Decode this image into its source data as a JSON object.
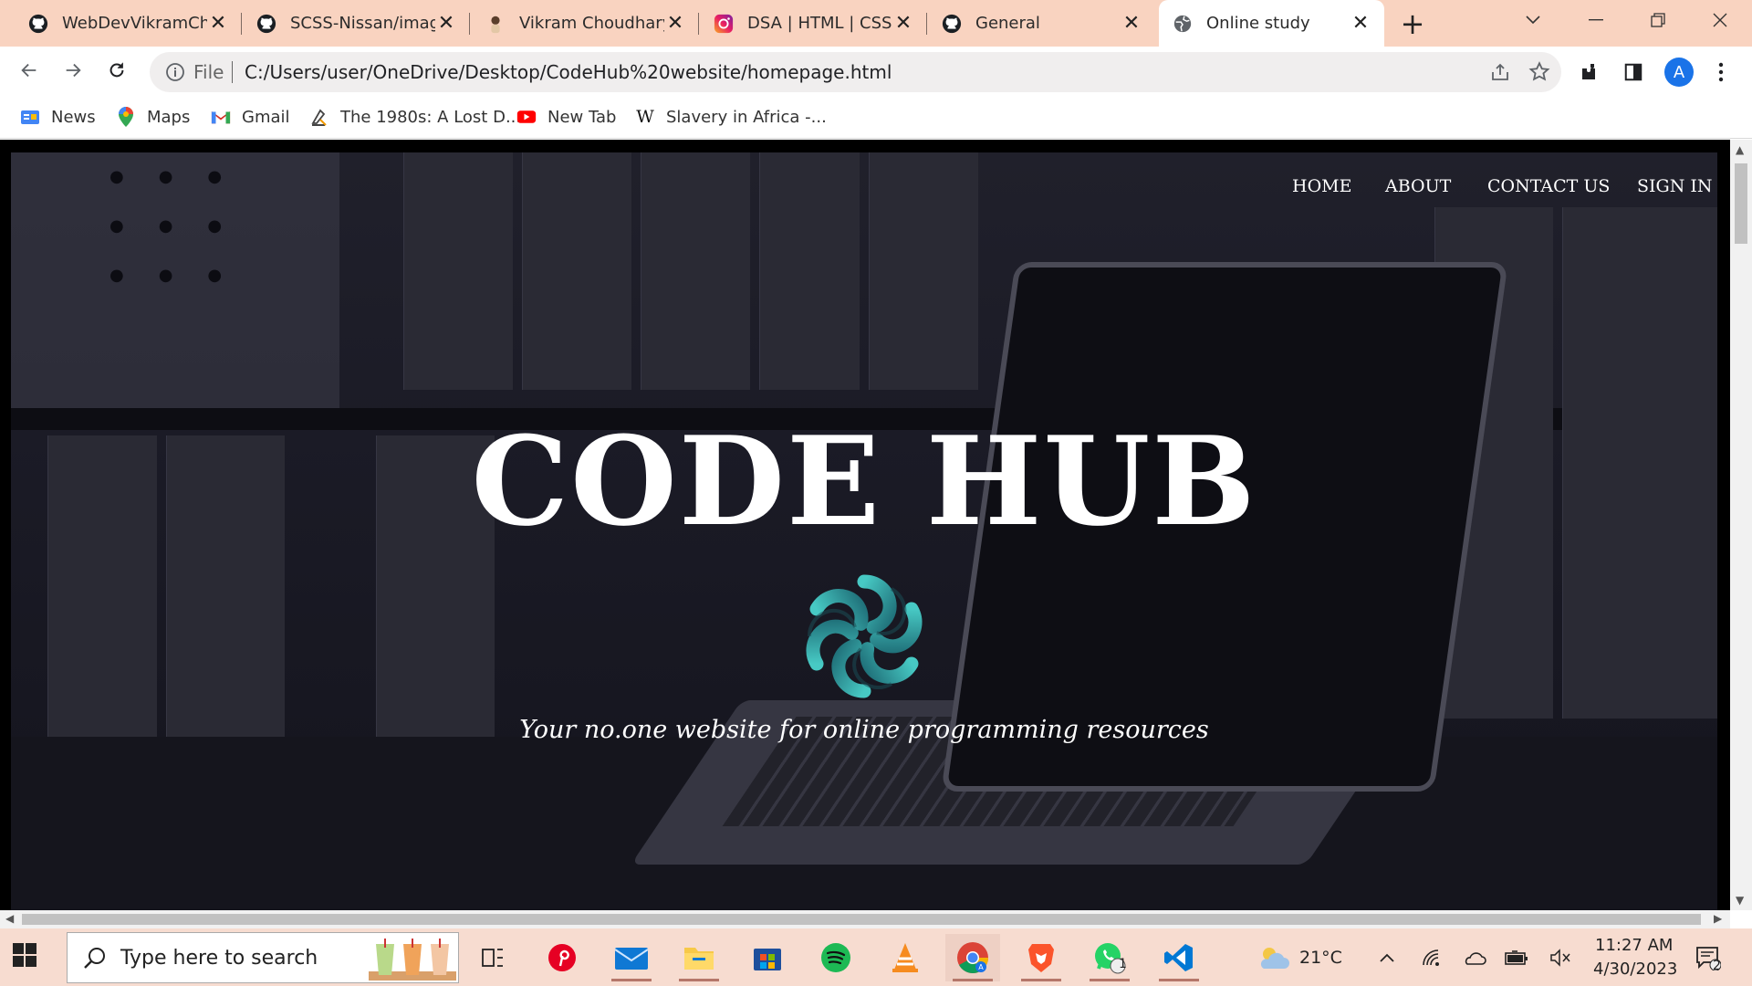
{
  "browser": {
    "tabs": [
      {
        "title": "WebDevVikramCho",
        "icon": "github-icon",
        "active": false
      },
      {
        "title": "SCSS-Nissan/image",
        "icon": "github-icon",
        "active": false
      },
      {
        "title": "Vikram Choudhary",
        "icon": "profile-icon",
        "active": false
      },
      {
        "title": "DSA | HTML | CSS |",
        "icon": "instagram-icon",
        "active": false
      },
      {
        "title": "General",
        "icon": "github-icon",
        "active": false
      },
      {
        "title": "Online study",
        "icon": "globe-icon",
        "active": true
      }
    ],
    "address": {
      "scheme_label": "File",
      "url": "C:/Users/user/OneDrive/Desktop/CodeHub%20website/homepage.html"
    },
    "profile_initial": "A",
    "bookmarks": [
      {
        "label": "News",
        "icon": "news-icon"
      },
      {
        "label": "Maps",
        "icon": "maps-icon"
      },
      {
        "label": "Gmail",
        "icon": "gmail-icon"
      },
      {
        "label": "The 1980s: A Lost D...",
        "icon": "bookmark-page-icon"
      },
      {
        "label": "New Tab",
        "icon": "youtube-icon"
      },
      {
        "label": "Slavery in Africa -...",
        "icon": "wikipedia-icon"
      }
    ]
  },
  "page": {
    "nav": {
      "home": "HOME",
      "about": "ABOUT",
      "contact": "CONTACT US",
      "signin": "SIGN IN"
    },
    "title": "CODE HUB",
    "tagline": "Your no.one website for online programming resources"
  },
  "taskbar": {
    "search_placeholder": "Type here to search",
    "weather": "21°C",
    "time": "11:27 AM",
    "date": "4/30/2023",
    "whatsapp_badge": "1",
    "notifications_badge": "2",
    "apps": [
      "task-view",
      "pinterest",
      "mail",
      "file-explorer",
      "microsoft-store",
      "spotify",
      "vlc",
      "chrome",
      "brave",
      "whatsapp",
      "vscode"
    ]
  },
  "colors": {
    "tabstrip": "#f9d3c0",
    "taskbar": "#f7dcd0",
    "accent": "#1a73e8",
    "logo_teal": "#2fb3b8"
  }
}
